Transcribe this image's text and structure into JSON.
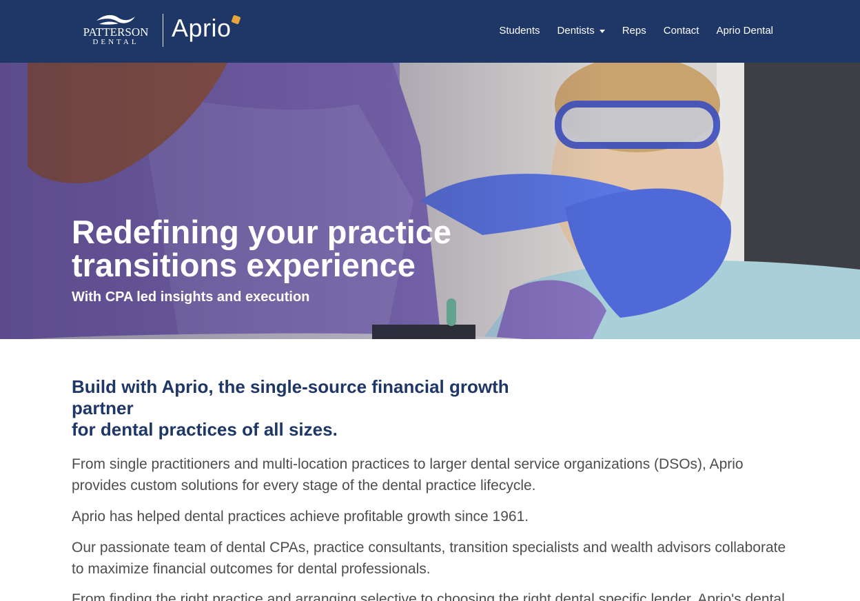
{
  "brand": {
    "patterson_name": "PATTERSON",
    "patterson_sub": "DENTAL",
    "aprio": "Aprio"
  },
  "nav": {
    "items": [
      {
        "label": "Students"
      },
      {
        "label": "Dentists"
      },
      {
        "label": "Reps"
      },
      {
        "label": "Contact"
      },
      {
        "label": "Aprio Dental"
      }
    ]
  },
  "hero": {
    "title_line1": "Redefining your practice",
    "title_line2": "transitions experience",
    "subtitle": "With CPA led insights and execution"
  },
  "content": {
    "headline_line1": "Build with Aprio, the single-source financial growth partner",
    "headline_line2": "for dental practices of all sizes.",
    "paragraphs": [
      "From single practitioners and multi-location practices to larger dental service organizations (DSOs), Aprio provides custom solutions for every stage of the dental practice lifecycle.",
      "Aprio has helped dental practices achieve profitable growth since 1961.",
      "Our passionate team of dental CPAs, practice consultants, transition specialists and wealth advisors collaborate to maximize financial outcomes for dental professionals.",
      "From finding the right practice and arranging selective to choosing the right dental specific lender, Aprio's dental"
    ]
  },
  "colors": {
    "nav_bg": "#1e3767",
    "headline": "#1e3767",
    "body_text": "#4d4d4d",
    "accent_dot": "#e8a43c"
  },
  "icons": [
    "patterson-swoosh-icon",
    "aprio-accent-dot",
    "dropdown-caret-icon"
  ]
}
